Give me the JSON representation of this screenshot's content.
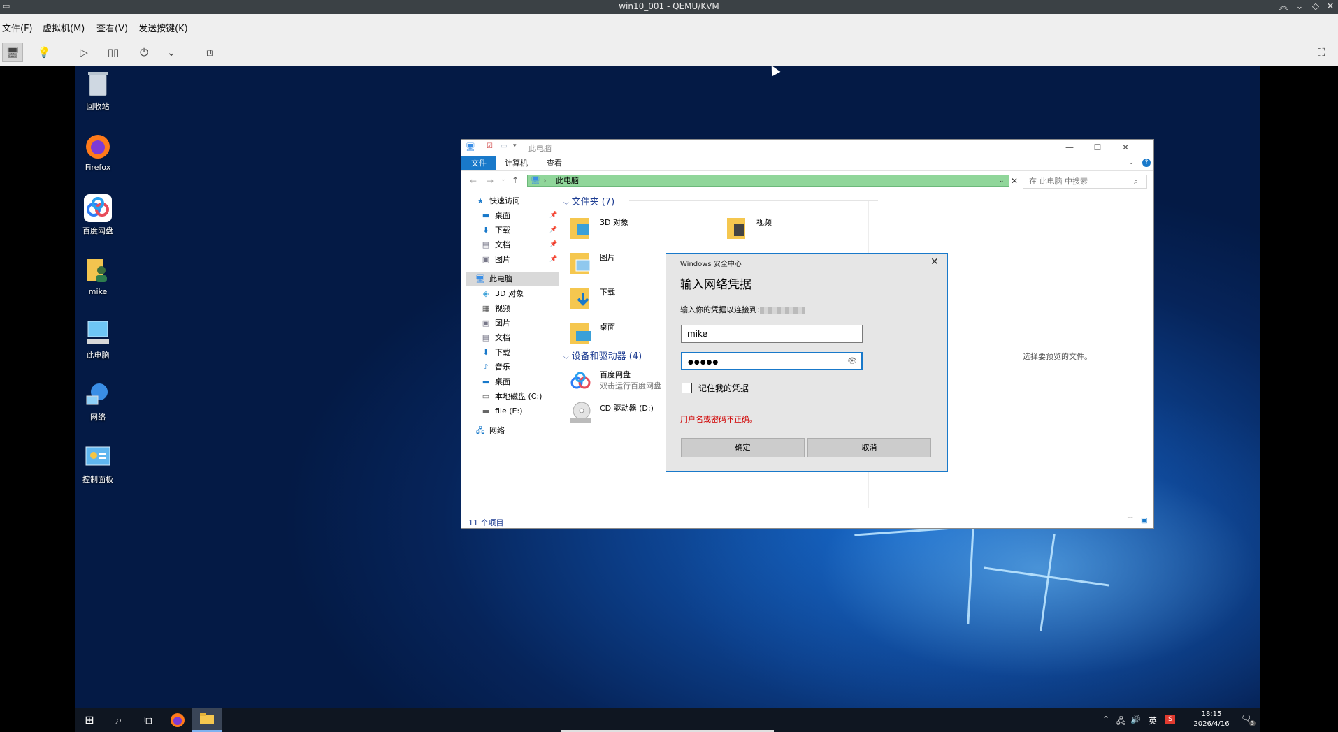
{
  "qemu": {
    "title": "win10_001 - QEMU/KVM",
    "menu": [
      "文件(F)",
      "虚拟机(M)",
      "查看(V)",
      "发送按键(K)"
    ]
  },
  "desktop": {
    "icons": [
      "回收站",
      "Firefox",
      "百度网盘",
      "mike",
      "此电脑",
      "网络",
      "控制面板"
    ]
  },
  "explorer": {
    "title": "此电脑",
    "ribbon_tabs": [
      "文件",
      "计算机",
      "查看"
    ],
    "address": "此电脑",
    "search_placeholder": "在 此电脑 中搜索",
    "sidebar": {
      "quick_access": "快速访问",
      "quick_items": [
        "桌面",
        "下载",
        "文档",
        "图片"
      ],
      "this_pc": "此电脑",
      "pc_items": [
        "3D 对象",
        "视频",
        "图片",
        "文档",
        "下载",
        "音乐",
        "桌面",
        "本地磁盘 (C:)",
        "file (E:)"
      ],
      "network": "网络"
    },
    "folders_header": "文件夹 (7)",
    "folders": [
      "3D 对象",
      "视频",
      "图片",
      "下载",
      "桌面"
    ],
    "devices_header": "设备和驱动器 (4)",
    "devices": [
      {
        "name": "百度网盘",
        "sub": "双击运行百度网盘"
      },
      {
        "name": "CD 驱动器 (D:)",
        "sub": ""
      }
    ],
    "preview_text": "选择要预览的文件。",
    "status": "11 个项目"
  },
  "dialog": {
    "title": "Windows 安全中心",
    "heading": "输入网络凭据",
    "subtitle": "输入你的凭据以连接到:",
    "username": "mike",
    "password_mask": "●●●●●",
    "remember_label": "记住我的凭据",
    "error": "用户名或密码不正确。",
    "ok": "确定",
    "cancel": "取消"
  },
  "taskbar": {
    "ime": "英",
    "time": "18:15",
    "date": "2026/4/16",
    "notification_count": "3"
  },
  "colors": {
    "accent": "#1979ca",
    "address_bar": "#90d69a",
    "error": "#d00000",
    "taskbar": "#0f1621"
  }
}
